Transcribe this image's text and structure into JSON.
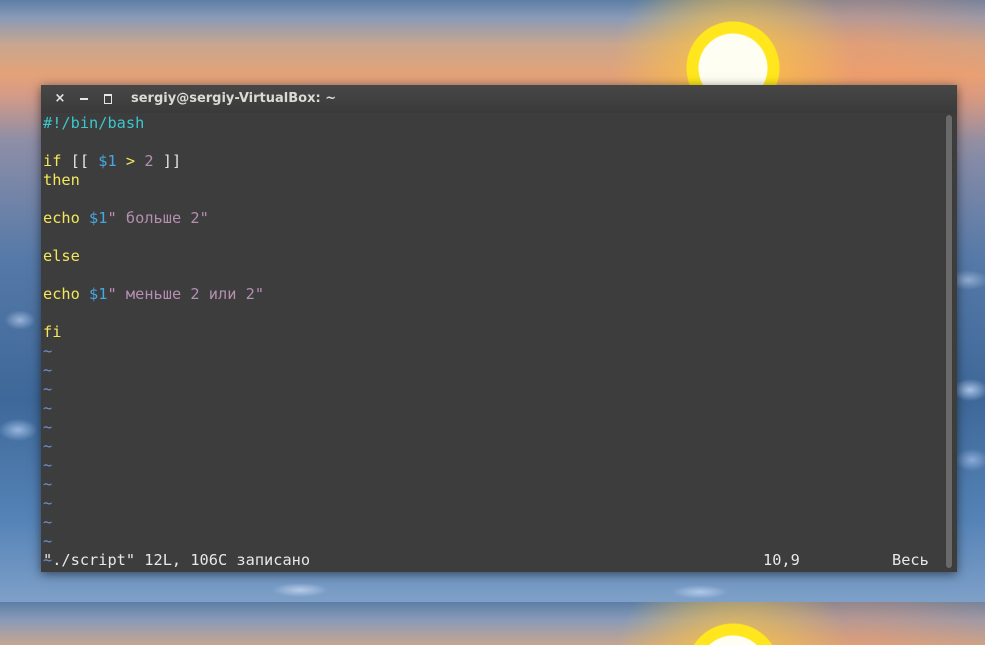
{
  "window": {
    "title": "sergiy@sergiy-VirtualBox: ~",
    "close_icon": "×",
    "minimize_icon": "minimize",
    "maximize_icon": "maximize"
  },
  "editor": {
    "shebang": "#!/bin/bash",
    "if_kw": "if",
    "if_open": " [[ ",
    "if_var": "$1",
    "if_op": " > ",
    "if_num": "2",
    "if_close": " ]]",
    "then_kw": "then",
    "echo1_kw": "echo",
    "echo1_var": " $1",
    "echo1_str": "\" больше 2\"",
    "else_kw": "else",
    "echo2_kw": "echo",
    "echo2_var": " $1",
    "echo2_str": "\" меньше 2 или 2\"",
    "fi_kw": "fi",
    "tilde": "~"
  },
  "status": {
    "file_info": "\"./script\" 12L, 106C записано",
    "cursor_pos": "10,9",
    "scroll_pos": "Весь"
  },
  "colors": {
    "keyword": "#f4e75d",
    "shebang": "#3ac8cf",
    "variable": "#45a8e0",
    "string": "#b58fb1",
    "tilde": "#6f8fd3",
    "terminal_bg": "#3d3d3d"
  }
}
